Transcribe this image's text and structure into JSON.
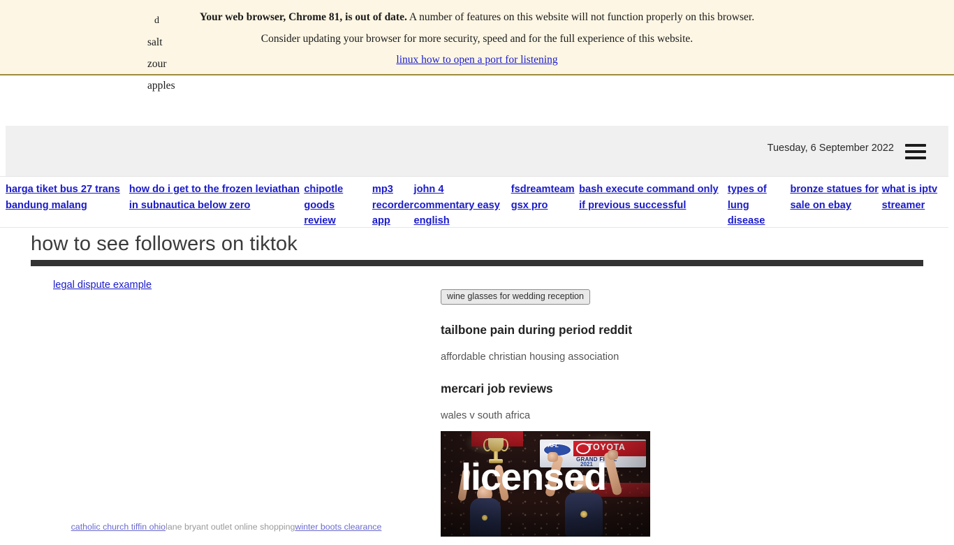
{
  "browser_banner": {
    "strong_text": "Your web browser, Chrome 81, is out of date.",
    "line1_rest": " A number of features on this website will not function properly on this browser.",
    "line2": "Consider updating your browser for more security, speed and for the full experience of this website.",
    "link_text": "linux how to open a port for listening",
    "background_color": "#fdf6e4",
    "border_color": "#9c8c3c",
    "link_color": "#1a1acc"
  },
  "stray_words": [
    "d",
    "salt",
    "zour",
    "apples"
  ],
  "utility_bar": {
    "date": "Tuesday, 6 September 2022",
    "menu_icon": "hamburger-menu-icon",
    "background_color": "#f0f0f0"
  },
  "nav_links": [
    "harga tiket bus 27 trans bandung malang",
    "how do i get to the frozen leviathan in subnautica below zero",
    "chipotle goods review",
    "mp3 recorder app",
    "john 4 commentary easy english",
    "fsdreamteam gsx pro",
    "bash execute command only if previous successful",
    "types of lung disease",
    "bronze statues for sale on ebay",
    "what is iptv streamer"
  ],
  "page_title": "how to see followers on tiktok",
  "title_rule_color": "#333333",
  "left_column": {
    "link": "legal dispute example",
    "bottom_links": [
      {
        "text": "catholic church tiffin ohio",
        "is_link": true
      },
      {
        "text": "lane bryant outlet online shopping",
        "is_link": false
      },
      {
        "text": "winter boots clearance",
        "is_link": true
      }
    ],
    "bottom_clipped_line": "cut off partial second line"
  },
  "right_column": {
    "tag": "wine glasses for wedding reception",
    "heading_1": "tailbone pain during period reddit",
    "paragraph_1": "affordable christian housing association",
    "heading_2": "mercari job reviews",
    "paragraph_2": "wales v south africa"
  },
  "photo": {
    "alt": "AFL Grand Final players celebrating with premiership cup",
    "overlay_text": "licensed",
    "overlay_color": "#ffffff",
    "board_afl": "AFL",
    "board_toyota": "TOYOTA",
    "board_grand_final": "GRAND FINAL",
    "board_year": "2021"
  }
}
